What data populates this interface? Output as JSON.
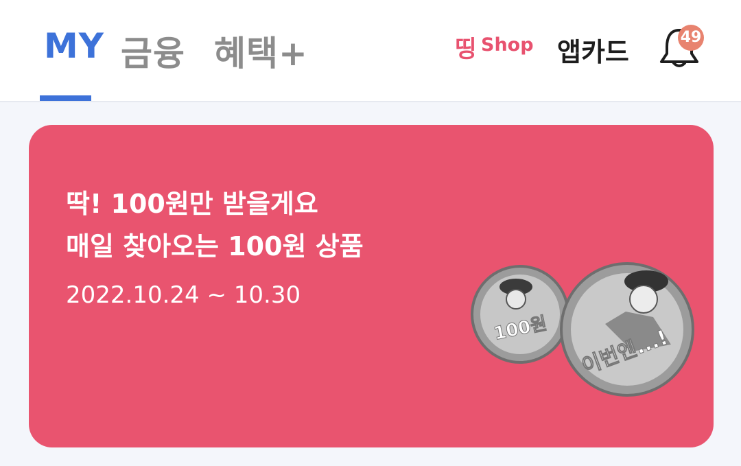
{
  "tabs": [
    {
      "label": "MY",
      "active": true
    },
    {
      "label": "금융",
      "active": false
    },
    {
      "label": "혜택+",
      "active": false
    }
  ],
  "header": {
    "shop_mark": "띵",
    "shop_label": "Shop",
    "app_card_label": "앱카드",
    "notification_count": "49"
  },
  "banner": {
    "line1": "딱! 100원만 받을게요",
    "line2": "매일 찾아오는 100원 상품",
    "date": "2022.10.24 ~ 10.30",
    "coin_small_text": "100원",
    "coin_large_text": "이번엔...!"
  },
  "colors": {
    "accent": "#3d72d9",
    "banner": "#e9546f",
    "badge": "#e8836f"
  }
}
